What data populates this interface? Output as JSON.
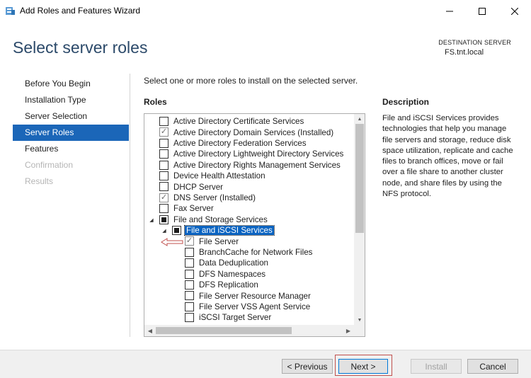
{
  "window": {
    "title": "Add Roles and Features Wizard",
    "controls": [
      "minimize-icon",
      "maximize-icon",
      "close-icon"
    ]
  },
  "header": {
    "page_title": "Select server roles",
    "destination_label": "DESTINATION SERVER",
    "destination_value": "FS.tnt.local"
  },
  "nav": {
    "items": [
      {
        "label": "Before You Begin",
        "state": "normal"
      },
      {
        "label": "Installation Type",
        "state": "normal"
      },
      {
        "label": "Server Selection",
        "state": "normal"
      },
      {
        "label": "Server Roles",
        "state": "active"
      },
      {
        "label": "Features",
        "state": "normal"
      },
      {
        "label": "Confirmation",
        "state": "disabled"
      },
      {
        "label": "Results",
        "state": "disabled"
      }
    ]
  },
  "content": {
    "intro": "Select one or more roles to install on the selected server.",
    "roles_heading": "Roles",
    "description_heading": "Description",
    "description_text": "File and iSCSI Services provides technologies that help you manage file servers and storage, reduce disk space utilization, replicate and cache files to branch offices, move or fail over a file share to another cluster node, and share files by using the NFS protocol."
  },
  "roles": [
    {
      "label": "Active Directory Certificate Services",
      "state": "unchecked",
      "level": 0
    },
    {
      "label": "Active Directory Domain Services (Installed)",
      "state": "checked-disabled",
      "level": 0
    },
    {
      "label": "Active Directory Federation Services",
      "state": "unchecked",
      "level": 0
    },
    {
      "label": "Active Directory Lightweight Directory Services",
      "state": "unchecked",
      "level": 0
    },
    {
      "label": "Active Directory Rights Management Services",
      "state": "unchecked",
      "level": 0
    },
    {
      "label": "Device Health Attestation",
      "state": "unchecked",
      "level": 0
    },
    {
      "label": "DHCP Server",
      "state": "unchecked",
      "level": 0
    },
    {
      "label": "DNS Server (Installed)",
      "state": "checked-disabled",
      "level": 0
    },
    {
      "label": "Fax Server",
      "state": "unchecked",
      "level": 0
    },
    {
      "label": "File and Storage Services",
      "state": "partial",
      "level": 0,
      "expanded": true
    },
    {
      "label": "File and iSCSI Services",
      "state": "partial",
      "level": 1,
      "expanded": true,
      "selected": true
    },
    {
      "label": "File Server",
      "state": "checked-disabled",
      "level": 2
    },
    {
      "label": "BranchCache for Network Files",
      "state": "unchecked",
      "level": 2
    },
    {
      "label": "Data Deduplication",
      "state": "unchecked",
      "level": 2
    },
    {
      "label": "DFS Namespaces",
      "state": "unchecked",
      "level": 2
    },
    {
      "label": "DFS Replication",
      "state": "unchecked",
      "level": 2
    },
    {
      "label": "File Server Resource Manager",
      "state": "unchecked",
      "level": 2
    },
    {
      "label": "File Server VSS Agent Service",
      "state": "unchecked",
      "level": 2
    },
    {
      "label": "iSCSI Target Server",
      "state": "unchecked",
      "level": 2
    }
  ],
  "buttons": {
    "previous": "< Previous",
    "next": "Next >",
    "install": "Install",
    "cancel": "Cancel"
  },
  "colors": {
    "accent": "#1b66b8",
    "title": "#2c4a6a",
    "annotation_arrow": "#c0504d"
  }
}
